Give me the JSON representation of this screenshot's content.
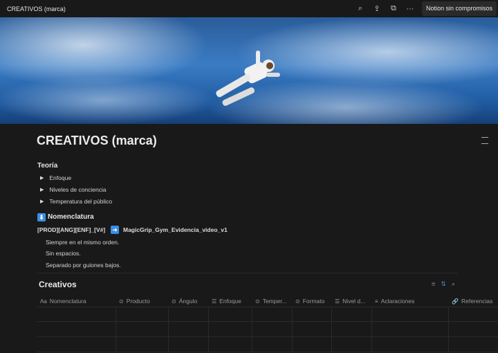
{
  "topbar": {
    "title": "CREATIVOS (marca)",
    "promo_label": "Notion sin compromisos",
    "icons": [
      "search-icon",
      "share-icon",
      "duplicate-icon",
      "more-icon"
    ]
  },
  "page": {
    "title": "CREATIVOS (marca)",
    "teoria": {
      "heading": "Teoría",
      "toggles": [
        "Enfoque",
        "Niveles de conciencia",
        "Temperatura del público"
      ]
    },
    "nomenclatura": {
      "heading": "Nomenclatura",
      "pattern": "[PROD][ANG][ENF]_[V#]",
      "example": "MagicGrip_Gym_Evidencia_video_v1",
      "notes": [
        "Siempre en el mismo orden.",
        "Sin espacios.",
        "Separado por guiones bajos."
      ]
    }
  },
  "database": {
    "title": "Creativos",
    "columns": [
      {
        "label": "Nomenclatura",
        "icon": "Aa"
      },
      {
        "label": "Producto",
        "icon": "⊙"
      },
      {
        "label": "Ángulo",
        "icon": "⊙"
      },
      {
        "label": "Enfoque",
        "icon": "☰"
      },
      {
        "label": "Temper...",
        "icon": "⊙"
      },
      {
        "label": "Formato",
        "icon": "⊙"
      },
      {
        "label": "Nivel d...",
        "icon": "☰"
      },
      {
        "label": "Aclaraciones",
        "icon": "≡"
      },
      {
        "label": "Referencias",
        "icon": "🔗"
      }
    ]
  },
  "colors": {
    "background": "#191919",
    "accent": "#4a8fe0"
  }
}
